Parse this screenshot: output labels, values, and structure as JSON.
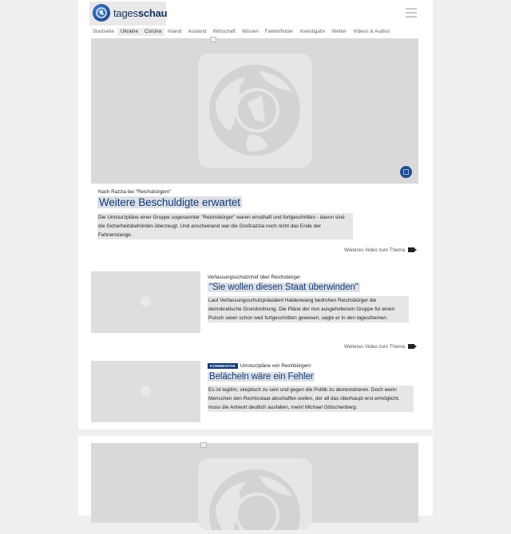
{
  "brand": {
    "name_light": "tages",
    "name_bold": "schau"
  },
  "nav": {
    "items": [
      {
        "label": "Startseite"
      },
      {
        "label": "Ukraine"
      },
      {
        "label": "Corona"
      },
      {
        "label": "Inland"
      },
      {
        "label": "Ausland"
      },
      {
        "label": "Wirtschaft"
      },
      {
        "label": "Wissen"
      },
      {
        "label": "Faktenfinder"
      },
      {
        "label": "Investigativ"
      },
      {
        "label": "Wetter"
      },
      {
        "label": "Videos & Audios"
      }
    ]
  },
  "lead": {
    "topline": "Nach Razzia bei \"Reichsbürgern\"",
    "headline": "Weitere Beschuldigte erwartet",
    "teaser": "Die Umsturzpläne einer Gruppe sogenannter \"Reichsbürger\" waren ernsthaft und fortgeschritten - davon sind die Sicherheitsbehörden überzeugt. Und anscheinend war die Großrazzia noch nicht das Ende der Fahnenstange.",
    "more_label": "Weiteres Video zum Thema"
  },
  "articles": [
    {
      "topline": "Verfassungsschutzchef über Reichsbürger",
      "headline": "\"Sie wollen diesen Staat überwinden\"",
      "teaser_main": "Laut Verfassungsschutzpräsident Haldenwang bedrohen Reichsbürger die demokratische Grundordnung. Die Pläne der nun ausgehobenen Gruppe für einen Putsch seien schon weit fortgeschritten gewesen, sagte er in den ",
      "teaser_italic": "tagesthemen",
      "teaser_end": ".",
      "more_label": "Weiteres Video zum Thema"
    },
    {
      "tag": "KOMMENTAR",
      "topline": "Umsturzpläne von Reichbürgern",
      "headline": "Belächeln wäre ein Fehler",
      "teaser_main": "Es ist legitim, skeptisch zu sein und gegen die Politik zu demonstrieren. Doch wenn Menschen den Rechtsstaat abschaffen wollen, der all das überhaupt erst ermöglicht, muss die Antwort deutlich ausfallen, ",
      "teaser_italic": "meint Michael Götschenberg",
      "teaser_end": "."
    }
  ],
  "colors": {
    "brand_blue": "#123a74",
    "placeholder_gray": "#d9d9d9",
    "page_bg": "#efefef"
  },
  "icons": {
    "logo": "tagesschau-globe-icon",
    "menu": "hamburger-menu-icon",
    "video": "video-camera-icon",
    "placeholder": "ard-globe-placeholder-icon"
  }
}
